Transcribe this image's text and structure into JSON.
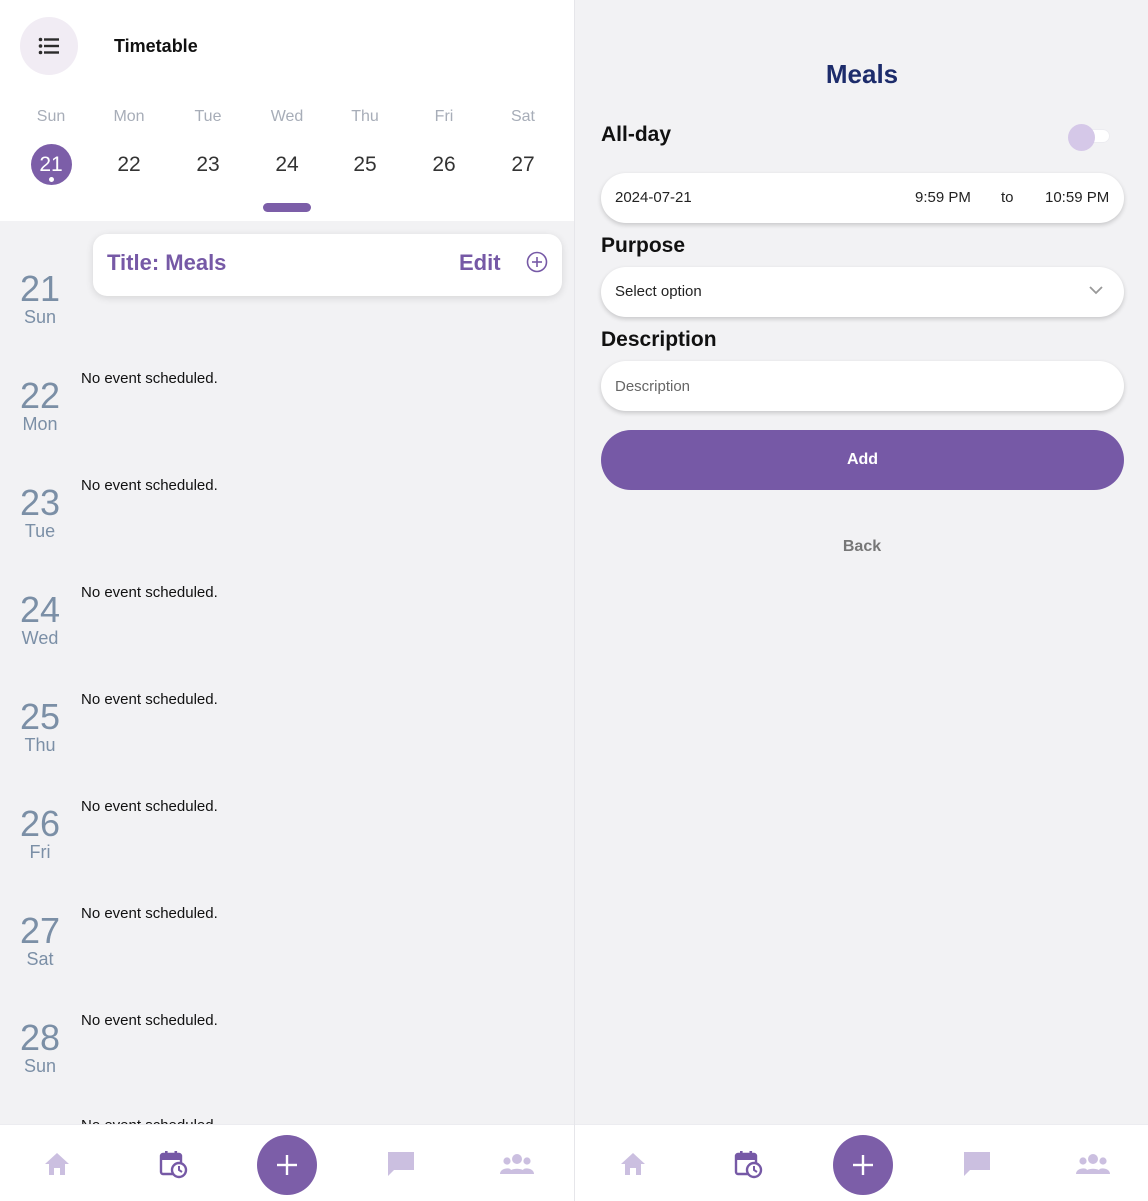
{
  "left": {
    "header": {
      "title": "Timetable",
      "menu_icon": "list-icon"
    },
    "week": [
      {
        "name": "Sun",
        "num": "21",
        "selected": true
      },
      {
        "name": "Mon",
        "num": "22"
      },
      {
        "name": "Tue",
        "num": "23"
      },
      {
        "name": "Wed",
        "num": "24"
      },
      {
        "name": "Thu",
        "num": "25"
      },
      {
        "name": "Fri",
        "num": "26"
      },
      {
        "name": "Sat",
        "num": "27"
      }
    ],
    "event_card": {
      "title": "Title: Meals",
      "edit": "Edit"
    },
    "agenda": [
      {
        "num": "21",
        "name": "Sun",
        "msg": ""
      },
      {
        "num": "22",
        "name": "Mon",
        "msg": "No event scheduled."
      },
      {
        "num": "23",
        "name": "Tue",
        "msg": "No event scheduled."
      },
      {
        "num": "24",
        "name": "Wed",
        "msg": "No event scheduled."
      },
      {
        "num": "25",
        "name": "Thu",
        "msg": "No event scheduled."
      },
      {
        "num": "26",
        "name": "Fri",
        "msg": "No event scheduled."
      },
      {
        "num": "27",
        "name": "Sat",
        "msg": "No event scheduled."
      },
      {
        "num": "28",
        "name": "Sun",
        "msg": "No event scheduled."
      },
      {
        "num": "",
        "name": "",
        "msg": "No event scheduled."
      }
    ]
  },
  "right": {
    "title": "Meals",
    "all_day_label": "All-day",
    "all_day_on": false,
    "date": "2024-07-21",
    "start_time": "9:59 PM",
    "to_label": "to",
    "end_time": "10:59 PM",
    "purpose_label": "Purpose",
    "purpose_value": "Select option",
    "description_label": "Description",
    "description_placeholder": "Description",
    "add_label": "Add",
    "back_label": "Back"
  },
  "nav": [
    "home-icon",
    "calendar-clock-icon",
    "add-icon",
    "chat-icon",
    "group-icon"
  ],
  "colors": {
    "accent": "#7c5ea8",
    "nav_icon": "#cbbfe0",
    "title_blue": "#1d2c6b"
  }
}
